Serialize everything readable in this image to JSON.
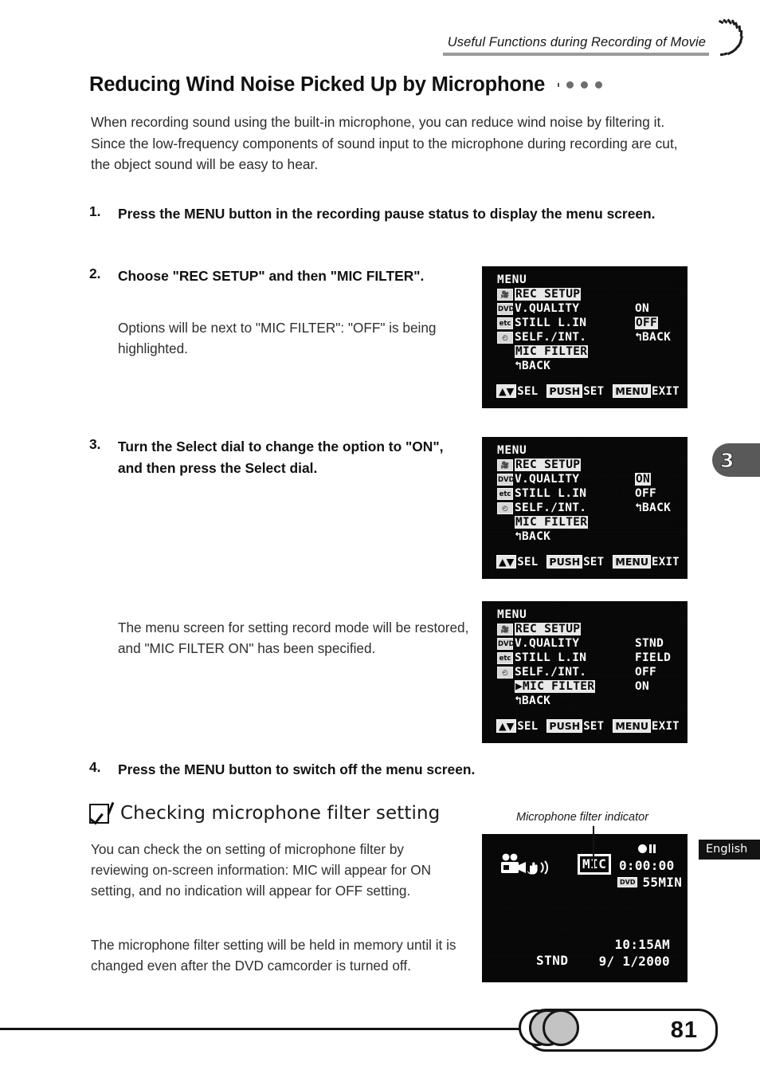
{
  "header": {
    "running_head": "Useful Functions during Recording of Movie",
    "swirl_icon": "swirl-arc-icon"
  },
  "title": {
    "text": "Reducing Wind Noise Picked Up by Microphone",
    "dots_count": 3
  },
  "intro": "When recording sound using the built-in microphone, you can reduce wind noise by filtering it. Since the low-frequency components of sound input to the microphone during recording are cut, the object sound will be easy to hear.",
  "steps": [
    {
      "num": "1.",
      "text": "Press the MENU button in the recording pause status to display the menu screen."
    },
    {
      "num": "2.",
      "text": "Choose \"REC SETUP\" and then \"MIC FILTER\"."
    },
    {
      "num": "3.",
      "text": "Turn the Select dial to change the option to \"ON\", and then press the Select dial."
    },
    {
      "num": "4.",
      "text": "Press the MENU button to switch off the menu screen."
    }
  ],
  "sub_notes": {
    "after_step2": "Options will be next to \"MIC FILTER\": \"OFF\" is being highlighted.",
    "after_step3": "The menu screen for setting record mode will be restored, and \"MIC FILTER ON\" has been specified."
  },
  "check_section": {
    "checkbox_icon": "checked-box-icon",
    "heading": "Checking microphone filter setting",
    "paragraph_1": "You can check the on setting of microphone filter by reviewing on-screen information: MIC will appear for ON setting, and no indication will appear for OFF setting.",
    "paragraph_2": "The microphone filter setting will be held in memory until it is changed even after the DVD camcorder is turned off."
  },
  "lcd_common": {
    "menu_title": "MENU",
    "icons": [
      "camera-icon",
      "DVD",
      "etc",
      "clock-icon"
    ],
    "bottom_bar": [
      {
        "key": "▲▼",
        "label": "SEL"
      },
      {
        "key": "PUSH",
        "label": "SET"
      },
      {
        "key": "MENU",
        "label": "EXIT"
      }
    ]
  },
  "lcd_screens": [
    {
      "id": "lcd-screen-1",
      "rows": [
        {
          "icon": "camera-icon",
          "label": "REC SETUP",
          "label_hl": true,
          "value": "",
          "value_hl": false
        },
        {
          "icon": "DVD",
          "label": "V.QUALITY",
          "label_hl": false,
          "value": "ON",
          "value_hl": false
        },
        {
          "icon": "etc",
          "label": "STILL L.IN",
          "label_hl": false,
          "value": "OFF",
          "value_hl": true
        },
        {
          "icon": "clock-icon",
          "label": "SELF./INT.",
          "label_hl": false,
          "value": "↰BACK",
          "value_hl": false
        },
        {
          "icon": "",
          "label": "MIC FILTER",
          "label_hl": true,
          "value": "",
          "value_hl": false
        },
        {
          "icon": "",
          "label": "↰BACK",
          "label_hl": false,
          "value": "",
          "value_hl": false
        }
      ]
    },
    {
      "id": "lcd-screen-2",
      "rows": [
        {
          "icon": "camera-icon",
          "label": "REC SETUP",
          "label_hl": true,
          "value": "",
          "value_hl": false
        },
        {
          "icon": "DVD",
          "label": "V.QUALITY",
          "label_hl": false,
          "value": "ON",
          "value_hl": true
        },
        {
          "icon": "etc",
          "label": "STILL L.IN",
          "label_hl": false,
          "value": "OFF",
          "value_hl": false
        },
        {
          "icon": "clock-icon",
          "label": "SELF./INT.",
          "label_hl": false,
          "value": "↰BACK",
          "value_hl": false
        },
        {
          "icon": "",
          "label": "MIC FILTER",
          "label_hl": true,
          "value": "",
          "value_hl": false
        },
        {
          "icon": "",
          "label": "↰BACK",
          "label_hl": false,
          "value": "",
          "value_hl": false
        }
      ]
    },
    {
      "id": "lcd-screen-3",
      "rows": [
        {
          "icon": "camera-icon",
          "label": "REC SETUP",
          "label_hl": true,
          "value": "",
          "value_hl": false
        },
        {
          "icon": "DVD",
          "label": "V.QUALITY",
          "label_hl": false,
          "value": "STND",
          "value_hl": false
        },
        {
          "icon": "etc",
          "label": "STILL L.IN",
          "label_hl": false,
          "value": "FIELD",
          "value_hl": false
        },
        {
          "icon": "clock-icon",
          "label": "SELF./INT.",
          "label_hl": false,
          "value": "OFF",
          "value_hl": false
        },
        {
          "icon": "",
          "label": "▶MIC FILTER",
          "label_hl": true,
          "value": "ON",
          "value_hl": false
        },
        {
          "icon": "",
          "label": "↰BACK",
          "label_hl": false,
          "value": "",
          "value_hl": false
        }
      ]
    }
  ],
  "viewfinder": {
    "callout_label": "Microphone filter indicator",
    "camera_icon": "movie-camera-icon",
    "stabilizer_icon": "hand-shake-icon",
    "mic_indicator": "MIC",
    "rec_pause_icon": "record-pause-icon",
    "timecode": "0:00:00",
    "media_icon": "DVD",
    "remaining": "55MIN",
    "quality_mode": "STND",
    "clock": "10:15AM",
    "date": "9/ 1/2000"
  },
  "chapter_tab": {
    "number": "3"
  },
  "language_badge": {
    "label": "English"
  },
  "footer": {
    "page_number": "81"
  }
}
